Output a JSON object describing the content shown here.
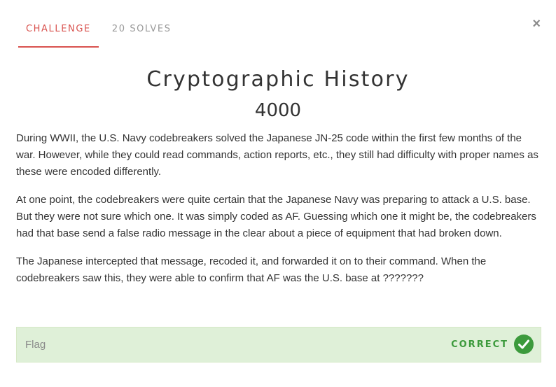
{
  "tabs": [
    {
      "label": "CHALLENGE",
      "active": true
    },
    {
      "label": "20 SOLVES",
      "active": false
    }
  ],
  "close_label": "×",
  "challenge": {
    "title": "Cryptographic History",
    "points": "4000",
    "description": [
      "During WWII, the U.S. Navy codebreakers solved the Japanese JN-25 code within the first few months of the war. However, while they could read commands, action reports, etc., they still had difficulty with proper names as these were encoded differently.",
      "At one point, the codebreakers were quite certain that the Japanese Navy was preparing to attack a U.S. base. But they were not sure which one. It was simply coded as AF. Guessing which one it might be, the codebreakers had that base send a false radio message in the clear about a piece of equipment that had broken down.",
      "The Japanese intercepted that message, recoded it, and forwarded it on to their command. When the codebreakers saw this, they were able to confirm that AF was the U.S. base at ???????"
    ]
  },
  "flag": {
    "placeholder": "Flag",
    "value": "",
    "status": "CORRECT",
    "status_icon": "check-circle-icon"
  },
  "colors": {
    "accent": "#d9534f",
    "success": "#3c9a3c",
    "success_bg": "#dff0d8"
  }
}
